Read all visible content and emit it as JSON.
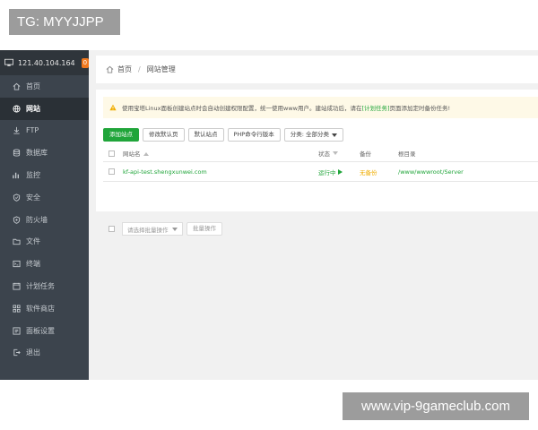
{
  "watermarks": {
    "top": "TG: MYYJJPP",
    "bottom": "www.vip-9gameclub.com"
  },
  "sidebar": {
    "server_ip": "121.40.104.164",
    "badge": "0",
    "items": [
      {
        "label": "首页",
        "icon": "home-icon"
      },
      {
        "label": "网站",
        "icon": "globe-icon"
      },
      {
        "label": "FTP",
        "icon": "ftp-icon"
      },
      {
        "label": "数据库",
        "icon": "database-icon"
      },
      {
        "label": "监控",
        "icon": "monitor-icon"
      },
      {
        "label": "安全",
        "icon": "shield-icon"
      },
      {
        "label": "防火墙",
        "icon": "firewall-icon"
      },
      {
        "label": "文件",
        "icon": "folder-icon"
      },
      {
        "label": "终端",
        "icon": "terminal-icon"
      },
      {
        "label": "计划任务",
        "icon": "clock-icon"
      },
      {
        "label": "软件商店",
        "icon": "grid-icon"
      },
      {
        "label": "面板设置",
        "icon": "settings-icon"
      },
      {
        "label": "退出",
        "icon": "logout-icon"
      }
    ],
    "active_index": 1
  },
  "breadcrumb": {
    "home": "首页",
    "current": "网站管理"
  },
  "alert": {
    "text_before": "使用宝塔Linux面板创建站点时会自动创建权限配置，统一使用www用户。建站成功后，请在",
    "link": "[计划任务]",
    "text_after": "页面添加定时备份任务!"
  },
  "toolbar": {
    "add_site": "添加站点",
    "default_page": "修改默认页",
    "default_site": "默认站点",
    "php_cli": "PHP命令行版本",
    "category": "分类: 全部分类"
  },
  "table": {
    "headers": {
      "name": "网站名",
      "status": "状态",
      "backup": "备份",
      "root": "根目录"
    },
    "rows": [
      {
        "name": "kf-api-test.shengxunwei.com",
        "status": "运行中",
        "backup": "无备份",
        "root": "/www/wwwroot/Server"
      }
    ]
  },
  "batch": {
    "select_placeholder": "请选择批量操作",
    "button": "批量操作"
  },
  "colors": {
    "accent": "#20a53a",
    "sidebar_bg": "#3c444d",
    "warning": "#f0ad00"
  }
}
